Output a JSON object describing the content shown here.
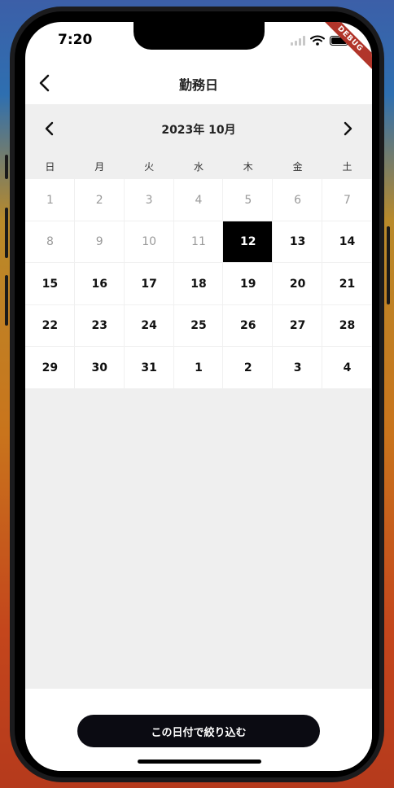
{
  "status_bar": {
    "time": "7:20",
    "debug_banner": "DEBUG"
  },
  "appbar": {
    "title": "勤務日",
    "back_icon": "chevron-left-icon"
  },
  "calendar": {
    "month_label": "2023年 10月",
    "weekdays": [
      "日",
      "月",
      "火",
      "水",
      "木",
      "金",
      "土"
    ],
    "days": [
      {
        "label": "1",
        "muted": true
      },
      {
        "label": "2",
        "muted": true
      },
      {
        "label": "3",
        "muted": true
      },
      {
        "label": "4",
        "muted": true
      },
      {
        "label": "5",
        "muted": true
      },
      {
        "label": "6",
        "muted": true
      },
      {
        "label": "7",
        "muted": true
      },
      {
        "label": "8",
        "muted": true
      },
      {
        "label": "9",
        "muted": true
      },
      {
        "label": "10",
        "muted": true
      },
      {
        "label": "11",
        "muted": true
      },
      {
        "label": "12",
        "selected": true
      },
      {
        "label": "13"
      },
      {
        "label": "14"
      },
      {
        "label": "15"
      },
      {
        "label": "16"
      },
      {
        "label": "17"
      },
      {
        "label": "18"
      },
      {
        "label": "19"
      },
      {
        "label": "20"
      },
      {
        "label": "21"
      },
      {
        "label": "22"
      },
      {
        "label": "23"
      },
      {
        "label": "24"
      },
      {
        "label": "25"
      },
      {
        "label": "26"
      },
      {
        "label": "27"
      },
      {
        "label": "28"
      },
      {
        "label": "29"
      },
      {
        "label": "30"
      },
      {
        "label": "31"
      },
      {
        "label": "1"
      },
      {
        "label": "2"
      },
      {
        "label": "3"
      },
      {
        "label": "4"
      }
    ]
  },
  "footer": {
    "button_label": "この日付で絞り込む"
  },
  "colors": {
    "selected_bg": "#000000",
    "button_bg": "#0b0b12",
    "muted_text": "#9a9a9a",
    "debug_red": "#b1352a"
  }
}
